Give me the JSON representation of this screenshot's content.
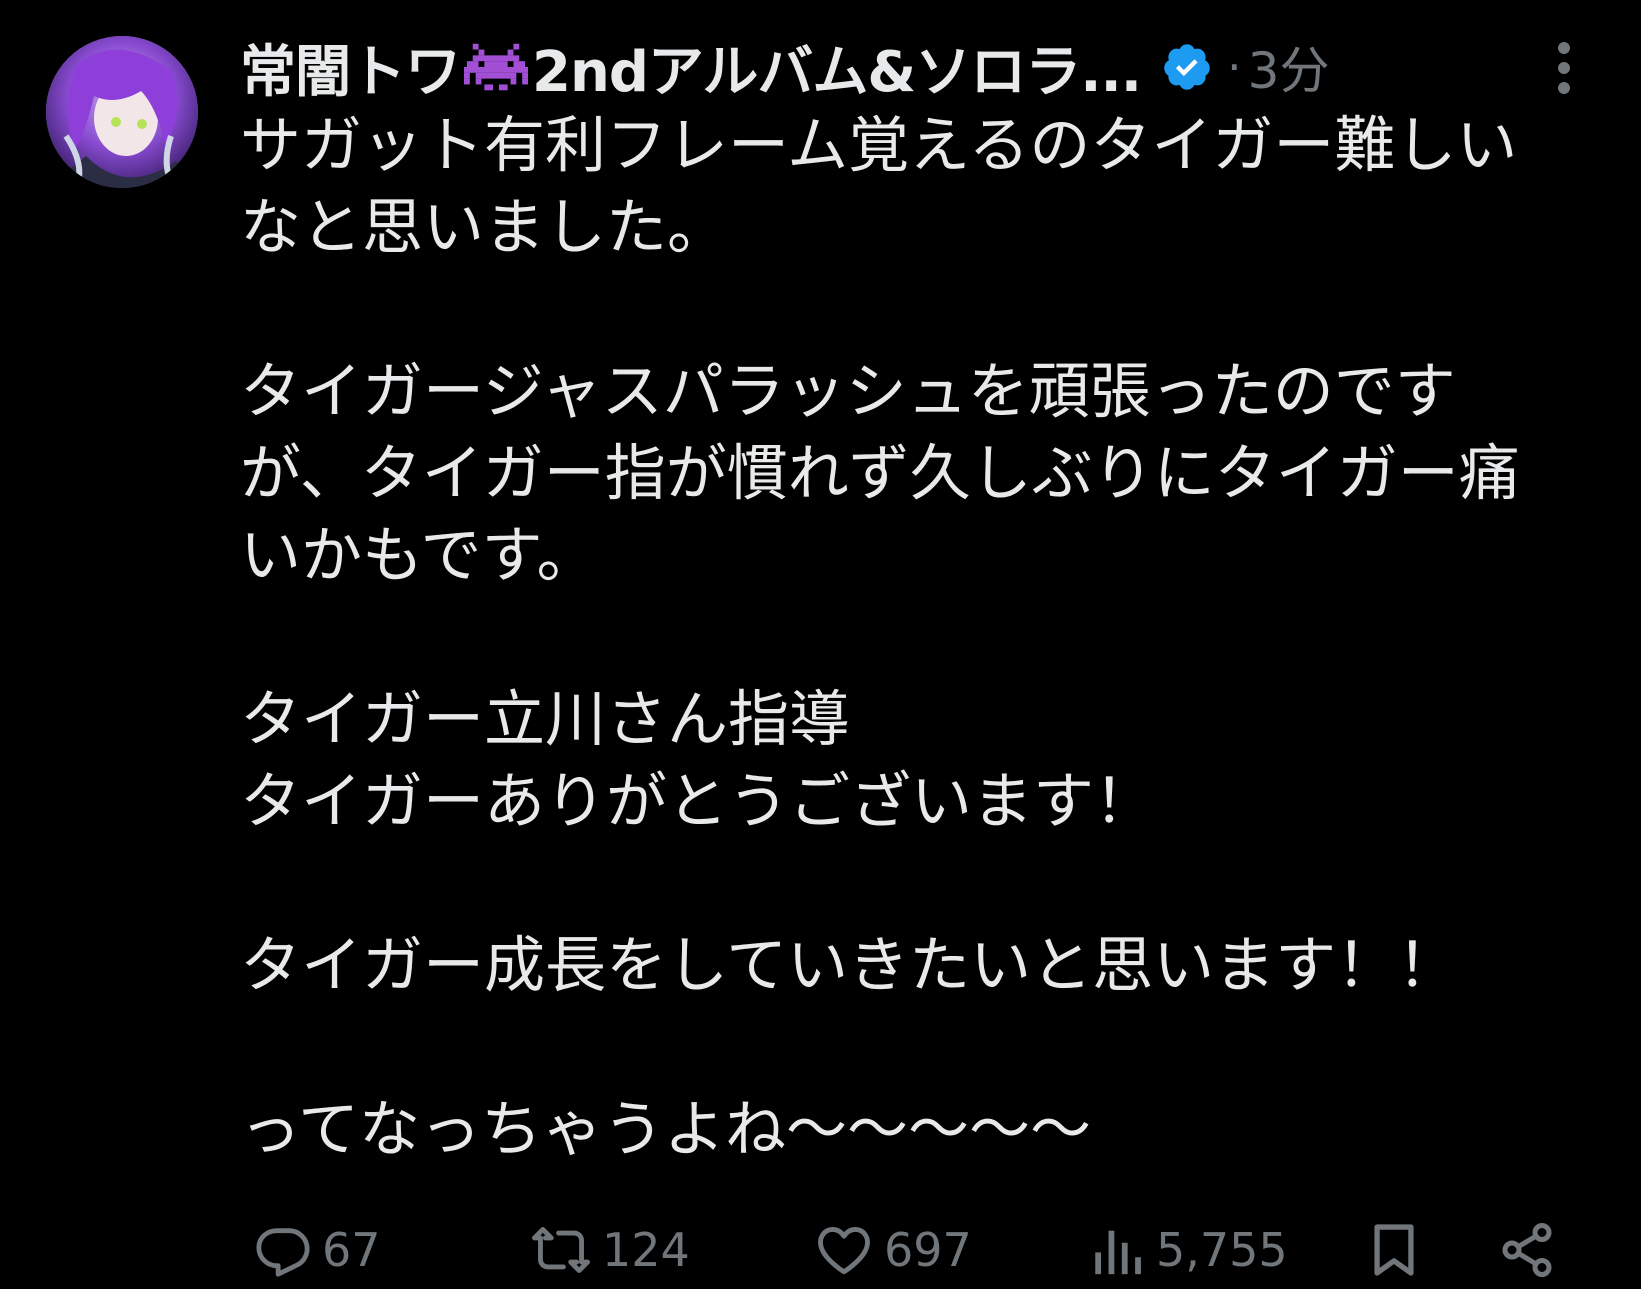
{
  "tweet": {
    "display_name_part1": "常闇トワ",
    "display_name_part2": "2ndアルバム&ソロラ...",
    "emoji_icon": "alien-monster-icon",
    "verified_icon": "verified-badge-icon",
    "separator": "·",
    "time": "3分",
    "body": "サガット有利フレーム覚えるのタイガー難しい\nなと思いました。\n\nタイガージャスパラッシュを頑張ったのです\nが、タイガー指が慣れず久しぶりにタイガー痛\nいかもです。\n\nタイガー立川さん指導\nタイガーありがとうございます！\n\nタイガー成長をしていきたいと思います！！\n\nってなっちゃうよね〜〜〜〜〜",
    "actions": {
      "replies": "67",
      "retweets": "124",
      "likes": "697",
      "views": "5,755"
    }
  },
  "colors": {
    "background": "#000000",
    "text_primary": "#e7e9ea",
    "text_secondary": "#71767b",
    "verified_blue": "#1d9bf0",
    "emoji_purple": "#9b59c5"
  }
}
